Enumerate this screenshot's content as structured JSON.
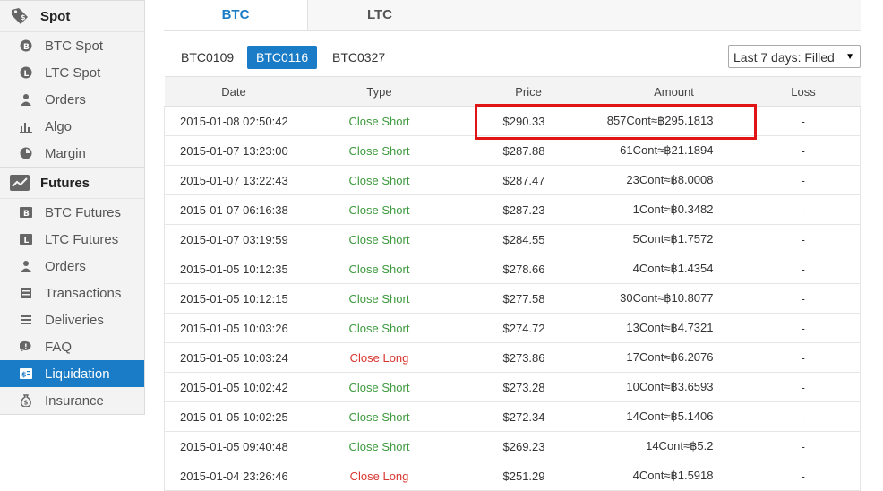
{
  "sidebar": {
    "spot": {
      "header": "Spot",
      "items": [
        {
          "label": "BTC Spot",
          "icon": "bitcoin-icon"
        },
        {
          "label": "LTC Spot",
          "icon": "litecoin-icon"
        },
        {
          "label": "Orders",
          "icon": "orders-icon"
        },
        {
          "label": "Algo",
          "icon": "algo-chart-icon"
        },
        {
          "label": "Margin",
          "icon": "margin-icon"
        }
      ]
    },
    "futures": {
      "header": "Futures",
      "items": [
        {
          "label": "BTC Futures",
          "icon": "btc-futures-icon"
        },
        {
          "label": "LTC Futures",
          "icon": "ltc-futures-icon"
        },
        {
          "label": "Orders",
          "icon": "orders-icon"
        },
        {
          "label": "Transactions",
          "icon": "transactions-icon"
        },
        {
          "label": "Deliveries",
          "icon": "deliveries-icon"
        },
        {
          "label": "FAQ",
          "icon": "faq-icon"
        },
        {
          "label": "Liquidation",
          "icon": "liquidation-icon",
          "active": true
        },
        {
          "label": "Insurance",
          "icon": "insurance-icon"
        }
      ]
    }
  },
  "tabs": [
    {
      "label": "BTC",
      "active": true
    },
    {
      "label": "LTC",
      "active": false
    }
  ],
  "contracts": [
    {
      "label": "BTC0109",
      "active": false
    },
    {
      "label": "BTC0116",
      "active": true
    },
    {
      "label": "BTC0327",
      "active": false
    }
  ],
  "filter": {
    "selected": "Last 7 days: Filled"
  },
  "table": {
    "headers": [
      "Date",
      "Type",
      "Price",
      "Amount",
      "Loss"
    ],
    "rows": [
      {
        "date": "2015-01-08 02:50:42",
        "type": "Close Short",
        "price": "$290.33",
        "amount": "857Cont≈฿295.1813",
        "loss": "-"
      },
      {
        "date": "2015-01-07 13:23:00",
        "type": "Close Short",
        "price": "$287.88",
        "amount": "61Cont≈฿21.1894",
        "loss": "-"
      },
      {
        "date": "2015-01-07 13:22:43",
        "type": "Close Short",
        "price": "$287.47",
        "amount": "23Cont≈฿8.0008",
        "loss": "-"
      },
      {
        "date": "2015-01-07 06:16:38",
        "type": "Close Short",
        "price": "$287.23",
        "amount": "1Cont≈฿0.3482",
        "loss": "-"
      },
      {
        "date": "2015-01-07 03:19:59",
        "type": "Close Short",
        "price": "$284.55",
        "amount": "5Cont≈฿1.7572",
        "loss": "-"
      },
      {
        "date": "2015-01-05 10:12:35",
        "type": "Close Short",
        "price": "$278.66",
        "amount": "4Cont≈฿1.4354",
        "loss": "-"
      },
      {
        "date": "2015-01-05 10:12:15",
        "type": "Close Short",
        "price": "$277.58",
        "amount": "30Cont≈฿10.8077",
        "loss": "-"
      },
      {
        "date": "2015-01-05 10:03:26",
        "type": "Close Short",
        "price": "$274.72",
        "amount": "13Cont≈฿4.7321",
        "loss": "-"
      },
      {
        "date": "2015-01-05 10:03:24",
        "type": "Close Long",
        "price": "$273.86",
        "amount": "17Cont≈฿6.2076",
        "loss": "-"
      },
      {
        "date": "2015-01-05 10:02:42",
        "type": "Close Short",
        "price": "$273.28",
        "amount": "10Cont≈฿3.6593",
        "loss": "-"
      },
      {
        "date": "2015-01-05 10:02:25",
        "type": "Close Short",
        "price": "$272.34",
        "amount": "14Cont≈฿5.1406",
        "loss": "-"
      },
      {
        "date": "2015-01-05 09:40:48",
        "type": "Close Short",
        "price": "$269.23",
        "amount": "14Cont≈฿5.2",
        "loss": "-"
      },
      {
        "date": "2015-01-04 23:26:46",
        "type": "Close Long",
        "price": "$251.29",
        "amount": "4Cont≈฿1.5918",
        "loss": "-"
      }
    ]
  },
  "colors": {
    "accent": "#1a7bc6",
    "close_short": "#3e9a3e",
    "close_long": "#d9352f",
    "highlight": "#e01414"
  }
}
